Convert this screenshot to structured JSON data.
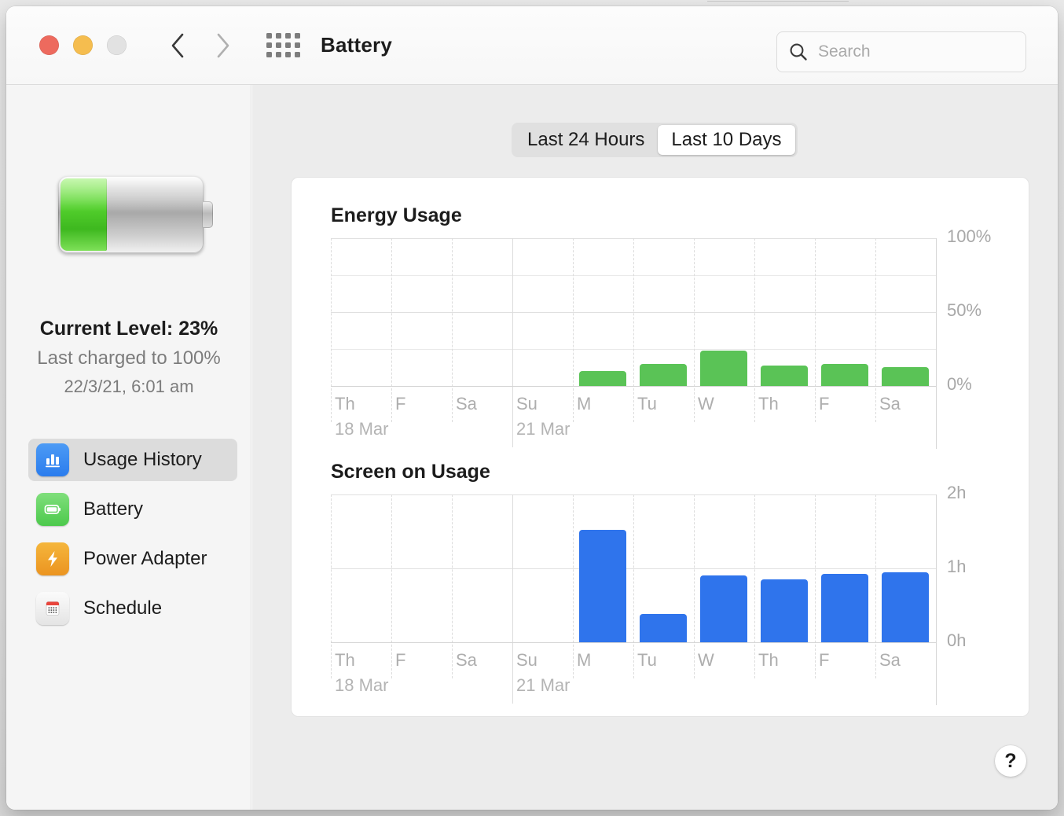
{
  "window": {
    "title": "Battery",
    "traffic_lights": [
      "close",
      "minimize",
      "zoom"
    ],
    "back_icon": "chevron-left-icon",
    "forward_icon": "chevron-right-icon",
    "show-all_icon": "grid-apps-icon"
  },
  "search": {
    "placeholder": "Search",
    "value": "",
    "icon": "search-icon"
  },
  "sidebar": {
    "battery_icon": "battery-graphic-icon",
    "battery_fill_percent": 33,
    "current_level": "Current Level: 23%",
    "last_charged": "Last charged to 100%",
    "charge_time": "22/3/21, 6:01 am",
    "items": [
      {
        "label": "Usage History",
        "icon": "bar-chart-icon",
        "selected": true
      },
      {
        "label": "Battery",
        "icon": "battery-icon",
        "selected": false
      },
      {
        "label": "Power Adapter",
        "icon": "bolt-icon",
        "selected": false
      },
      {
        "label": "Schedule",
        "icon": "calendar-icon",
        "selected": false
      }
    ]
  },
  "segmented_control": {
    "options": [
      "Last 24 Hours",
      "Last 10 Days"
    ],
    "selected": "Last 10 Days"
  },
  "help_button": {
    "label": "?"
  },
  "colors": {
    "energy_bar": "#5ac356",
    "screen_bar": "#2f74ec",
    "accent_blue": "#2a7ced",
    "sidebar_bg": "#f5f5f5",
    "content_bg": "#ececec"
  },
  "chart_data": [
    {
      "type": "bar",
      "title": "Energy Usage",
      "categories": [
        "Th",
        "F",
        "Sa",
        "Su",
        "M",
        "Tu",
        "W",
        "Th",
        "F",
        "Sa"
      ],
      "date_labels": [
        {
          "index": 0,
          "text": "18 Mar"
        },
        {
          "index": 3,
          "text": "21 Mar"
        }
      ],
      "values": [
        0,
        0,
        0,
        0,
        10,
        15,
        24,
        14,
        15,
        13
      ],
      "ylabel": "",
      "xlabel": "",
      "ytick_labels": [
        "100%",
        "50%",
        "0%"
      ],
      "ytick_values": [
        100,
        50,
        0
      ],
      "ylim": [
        0,
        100
      ],
      "grid": true,
      "legend": "none",
      "bar_color": "#5ac356"
    },
    {
      "type": "bar",
      "title": "Screen on Usage",
      "categories": [
        "Th",
        "F",
        "Sa",
        "Su",
        "M",
        "Tu",
        "W",
        "Th",
        "F",
        "Sa"
      ],
      "date_labels": [
        {
          "index": 0,
          "text": "18 Mar"
        },
        {
          "index": 3,
          "text": "21 Mar"
        }
      ],
      "values": [
        0,
        0,
        0,
        0,
        1.52,
        0.38,
        0.9,
        0.85,
        0.93,
        0.95
      ],
      "ylabel": "",
      "xlabel": "",
      "ytick_labels": [
        "2h",
        "1h",
        "0h"
      ],
      "ytick_values": [
        2,
        1,
        0
      ],
      "ylim": [
        0,
        2
      ],
      "grid": true,
      "legend": "none",
      "bar_color": "#2f74ec"
    }
  ]
}
